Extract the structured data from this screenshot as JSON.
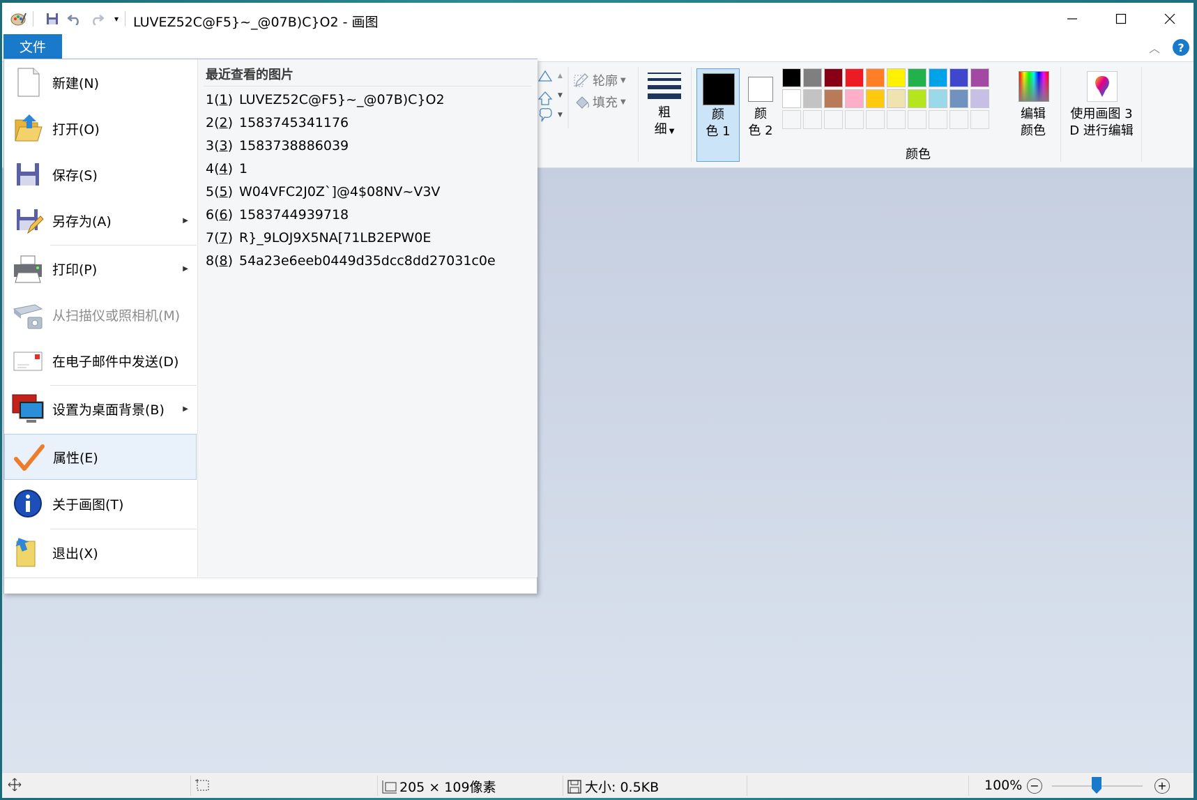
{
  "window": {
    "title": "LUVEZ52C@F5}~_@07B)C}O2 - 画图",
    "controls": {
      "minimize": "—",
      "maximize": "☐",
      "close": "✕"
    },
    "help": "?"
  },
  "file_menu": {
    "tab_label": "文件",
    "items": [
      {
        "label": "新建(N)"
      },
      {
        "label": "打开(O)"
      },
      {
        "label": "保存(S)"
      },
      {
        "label": "另存为(A)"
      },
      {
        "label": "打印(P)"
      },
      {
        "label": "从扫描仪或照相机(M)"
      },
      {
        "label": "在电子邮件中发送(D)"
      },
      {
        "label": "设置为桌面背景(B)"
      },
      {
        "label": "属性(E)"
      },
      {
        "label": "关于画图(T)"
      },
      {
        "label": "退出(X)"
      }
    ],
    "recent_title": "最近查看的图片",
    "recent": [
      {
        "num": "1",
        "key": "1",
        "name": "LUVEZ52C@F5}~_@07B)C}O2"
      },
      {
        "num": "2",
        "key": "2",
        "name": "1583745341176"
      },
      {
        "num": "3",
        "key": "3",
        "name": "1583738886039"
      },
      {
        "num": "4",
        "key": "4",
        "name": "1"
      },
      {
        "num": "5",
        "key": "5",
        "name": "W04VFC2J0Z`]@4$08NV~V3V"
      },
      {
        "num": "6",
        "key": "6",
        "name": "1583744939718"
      },
      {
        "num": "7",
        "key": "7",
        "name": "R}_9LOJ9X5NA[71LB2EPW0E"
      },
      {
        "num": "8",
        "key": "8",
        "name": "54a23e6eeb0449d35dcc8dd27031c0e"
      }
    ]
  },
  "ribbon": {
    "outline": "轮廓",
    "fill": "填充",
    "size": [
      "粗",
      "细"
    ],
    "color1": [
      "颜",
      "色 1"
    ],
    "color2": [
      "颜",
      "色 2"
    ],
    "edit_colors": [
      "编辑",
      "颜色"
    ],
    "paint3d": [
      "使用画图 3",
      "D 进行编辑"
    ],
    "colors_group": "颜色",
    "palette": [
      "#000000",
      "#7f7f7f",
      "#880015",
      "#ed1c24",
      "#ff7f27",
      "#fff200",
      "#22b14c",
      "#00a2e8",
      "#3f48cc",
      "#a349a4",
      "#ffffff",
      "#c3c3c3",
      "#b97a57",
      "#ffaec9",
      "#ffc90e",
      "#efe4b0",
      "#b5e61d",
      "#99d9ea",
      "#7092be",
      "#c8bfe7"
    ],
    "color1_value": "#000000",
    "color2_value": "#ffffff"
  },
  "status": {
    "dimensions": "205 × 109像素",
    "size": "大小: 0.5KB",
    "zoom": "100%"
  },
  "colors": {
    "accent": "#1979ca",
    "canvas": "#c6cfe0",
    "selected": "#cce4f7"
  }
}
